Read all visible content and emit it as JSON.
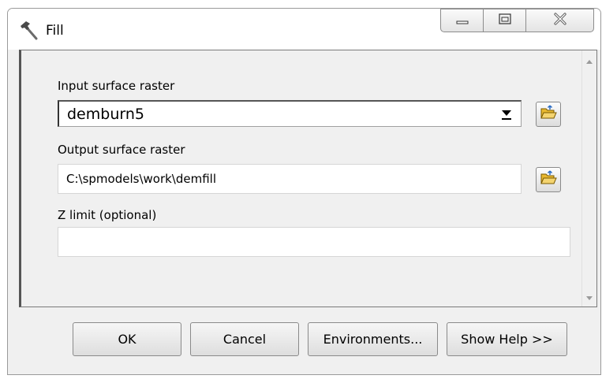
{
  "window": {
    "title": "Fill",
    "icon": "hammer-icon"
  },
  "caption": {
    "minimize_icon": "minimize-icon",
    "maximize_icon": "maximize-icon",
    "close_icon": "close-icon"
  },
  "form": {
    "input_label": "Input surface raster",
    "input_value": "demburn5",
    "output_label": "Output surface raster",
    "output_value": "C:\\spmodels\\work\\demfill",
    "zlimit_label": "Z limit (optional)",
    "zlimit_value": "",
    "browse_icon": "open-folder-icon"
  },
  "buttons": {
    "ok": "OK",
    "cancel": "Cancel",
    "environments": "Environments...",
    "show_help": "Show Help >>"
  },
  "colors": {
    "window_bg": "#f0f0f0",
    "folder_yellow": "#f4c842"
  }
}
